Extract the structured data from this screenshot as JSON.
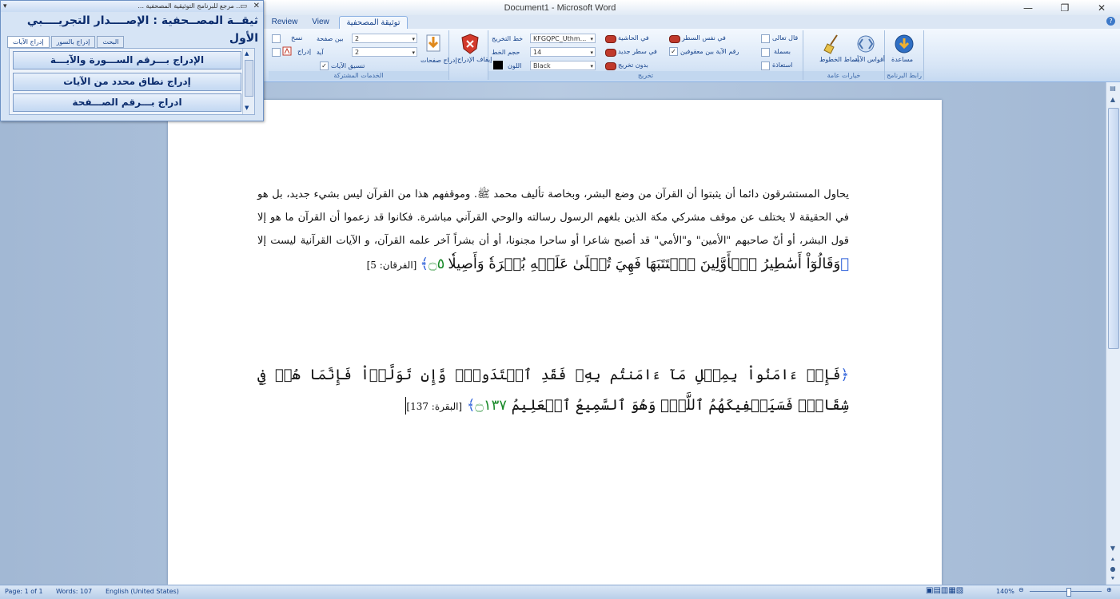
{
  "window": {
    "title": "Document1 - Microsoft Word",
    "minimize": "—",
    "maximize": "❐",
    "close": "✕"
  },
  "tabs": [
    {
      "label": "Review"
    },
    {
      "label": "View"
    },
    {
      "label": "توثيقة المصحفية",
      "active": true
    }
  ],
  "ribbon": {
    "groups": {
      "shared_services": "الخدمات المشتركة",
      "output": "تخريج",
      "general_options": "خيارات عامة",
      "program_link": "رابط البرنامج"
    },
    "shared": {
      "style_label": "نسخ",
      "insert_label": "إدراج",
      "combo1": "2",
      "combo2": "2",
      "combo_label1": "بين صفحة",
      "combo_label2": "آية",
      "check_label": "تنسيق الآيات",
      "insert_pages": "إدراج صفحات",
      "cancel_label": "إيقاف الإدراج"
    },
    "output": {
      "font_label": "خط التخريج",
      "font_value": "KFGQPC_Uthm...",
      "size_label": "حجم الخط",
      "size_value": "14",
      "color_label": "اللون",
      "color_value": "Black",
      "opt1": "في الحاشية",
      "opt2": "في نفس السطر",
      "opt3": "في سطر جديد",
      "opt4": "رقم الآية بين معقوفين",
      "opt5": "بدون تخريج"
    },
    "general": {
      "chk1": "قال تعالى",
      "chk2": "بسملة",
      "chk3": "استعاذة",
      "brush_label": "أنماط الخطوط",
      "brackets_label": "أقواس الآية"
    },
    "program": {
      "help_label": "مساعدة"
    }
  },
  "document": {
    "para1": "يحاول المستشرقون دائما أن يثبتوا أن القرآن من وضع البشر، وبخاصة تأليف محمد ﷺ. وموقفهم هذا من القرآن ليس بشيء جديد، بل هو في الحقيقة لا يختلف عن موقف مشركي مكة الذين بلغهم الرسول رسالته والوحي القرآني مباشرة. فكانوا قد زعموا أن القرآن ما هو إلا قول البشر، أو أنّ صاحبهم \"الأمين\" و\"الأمي\" قد أصبح شاعرا أو ساحرا مجنونا، أو أن بشراً آخر علمه القرآن، و الآيات القرآنية ليست إلا",
    "verse1_open": "﴿",
    "verse1": "وَقَالُوٓاْ أَسَٰطِيرُ ٱلۡأَوَّلِينَ ٱكۡتَتَبَهَا فَهِيَ تُمۡلَىٰ عَلَيۡهِ بُكۡرَةٗ وَأَصِيلٗا",
    "verse1_marker": "۝٥",
    "verse1_close": "﴾",
    "verse1_ref": "[الفرقان: 5]",
    "verse2_open": "﴿",
    "verse2": "فَإِنۡ ءَامَنُواْ بِمِثۡلِ مَآ ءَامَنتُم بِهِۦ فَقَدِ ٱهۡتَدَواْۖ وَّإِن تَوَلَّوۡاْ فَإِنَّمَا هُمۡ فِي شِقَاقٖۖ فَسَيَكۡفِيكَهُمُ ٱللَّهُۚ وَهُوَ ٱلسَّمِيعُ ٱلۡعَلِيمُ",
    "verse2_marker": "۝١٣٧",
    "verse2_close": "﴾",
    "verse2_ref": "[البقرة: 137]"
  },
  "statusbar": {
    "page": "Page: 1 of 1",
    "words": "Words: 107",
    "language": "English (United States)",
    "zoom": "140%"
  },
  "panel": {
    "title": "... مرجع للبرنامج التوثيقية المصحفية ...",
    "heading": "ثيقــة المصــحفية : الإصــــدار التجريــــبي الأول",
    "tabs": [
      "إدراج الآيات",
      "إدراج بالسور",
      "البحث"
    ],
    "buttons": [
      "الإدراج بـــرقم الســـورة والآيـــة",
      "إدراج نطاق محدد من الآيات",
      "ادراج بـــرقم الصـــفحة"
    ]
  }
}
